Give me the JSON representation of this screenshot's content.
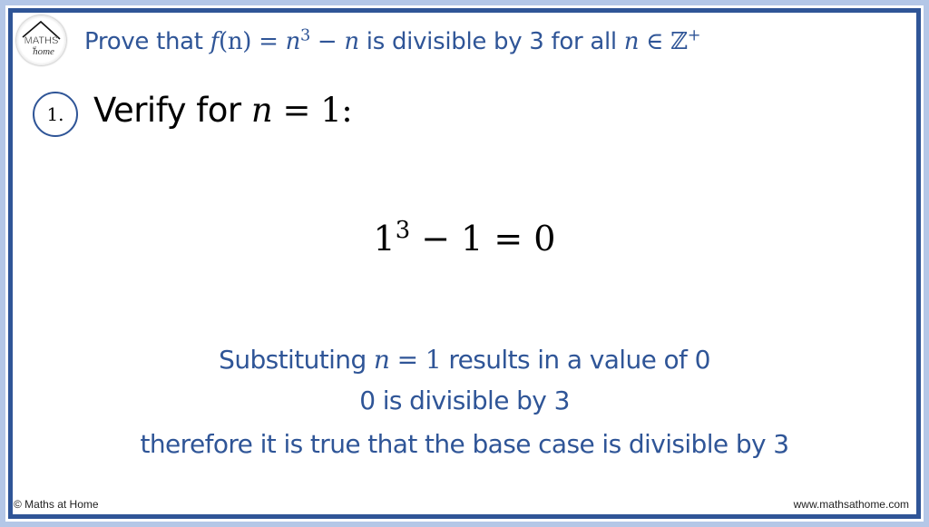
{
  "logo": {
    "line1": "MATHS",
    "line2": "at",
    "line3": "home"
  },
  "title": {
    "prefix": "Prove that ",
    "func": "f",
    "arg": "(n)",
    "eq": " = ",
    "base": "n",
    "exp": "3",
    "minus": " − ",
    "var": "n",
    "middle": " is divisible by 3 for all ",
    "var2": "n",
    "in": " ∈ ",
    "set": "ℤ",
    "set_sup": "+"
  },
  "step": {
    "number": "1.",
    "text": "Verify for ",
    "var": "n",
    "eq": " = 1:"
  },
  "equation": {
    "base": "1",
    "exp": "3",
    "rest": " − 1 = 0"
  },
  "explanation": {
    "line1_prefix": "Substituting ",
    "line1_var": "n",
    "line1_eq": " = 1",
    "line1_suffix": " results in a value of 0",
    "line2": "0 is divisible by 3",
    "line3": "therefore it is true that the base case is divisible by 3"
  },
  "footer": {
    "copyright": "© Maths at Home",
    "website": "www.mathsathome.com"
  },
  "colors": {
    "accent": "#2f5597",
    "outer_border": "#b4c7e7",
    "text": "#000000"
  }
}
